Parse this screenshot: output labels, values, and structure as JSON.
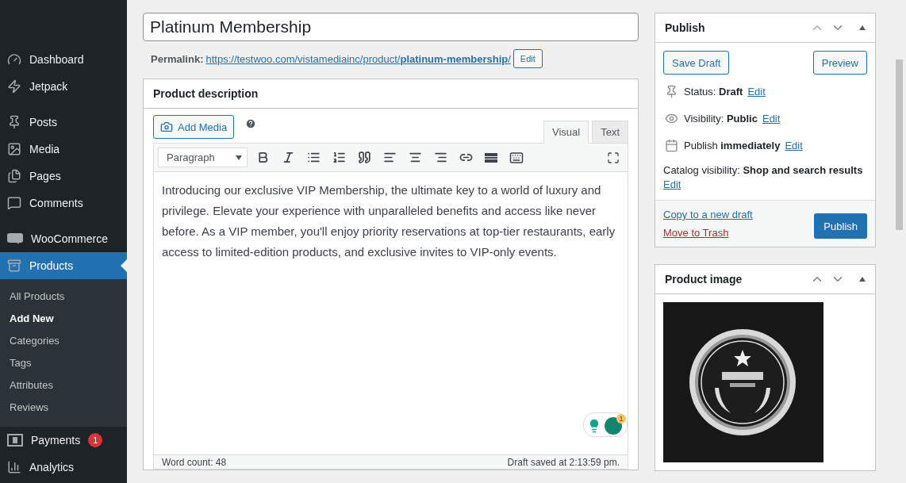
{
  "sidebar": {
    "groups": [
      [
        {
          "label": "Dashboard",
          "selected": false
        },
        {
          "label": "Jetpack",
          "selected": false
        }
      ],
      [
        {
          "label": "Posts",
          "selected": false
        },
        {
          "label": "Media",
          "selected": false
        },
        {
          "label": "Pages",
          "selected": false
        },
        {
          "label": "Comments",
          "selected": false
        }
      ],
      [
        {
          "label": "WooCommerce",
          "selected": false
        },
        {
          "label": "Products",
          "selected": true,
          "children": [
            {
              "label": "All Products",
              "selected": false
            },
            {
              "label": "Add New",
              "selected": true
            },
            {
              "label": "Categories",
              "selected": false
            },
            {
              "label": "Tags",
              "selected": false
            },
            {
              "label": "Attributes",
              "selected": false
            },
            {
              "label": "Reviews",
              "selected": false
            }
          ]
        },
        {
          "label": "Payments",
          "selected": false,
          "badge": "1"
        },
        {
          "label": "Analytics",
          "selected": false
        }
      ]
    ]
  },
  "title_field": {
    "value": "Platinum Membership"
  },
  "permalink": {
    "label": "Permalink:",
    "url": "https://testwoo.com/vistamediainc/product/**platinum-membership**/",
    "button": "Edit"
  },
  "description": {
    "title": "Product description",
    "add_media": "Add Media",
    "tabs": [
      {
        "label": "Visual",
        "selected": true
      },
      {
        "label": "Text",
        "selected": false
      }
    ],
    "format": "Paragraph",
    "body": "Introducing our exclusive VIP Membership, the ultimate key to a world of luxury and privilege. Elevate your experience with unparalleled benefits and access like never before. As a VIP member, you'll enjoy priority reservations at top-tier restaurants, early access to limited-edition products, and exclusive invites to VIP-only events.",
    "grammarly_badge": "1",
    "word_count": "Word count: 48",
    "draft_saved": "Draft saved at 2:13:59 pm."
  },
  "publish": {
    "title": "Publish",
    "save_draft": "Save Draft",
    "preview": "Preview",
    "rows": [
      {
        "text": "Status: **Draft**",
        "link": "Edit"
      },
      {
        "text": "Visibility: **Public**",
        "link": "Edit"
      },
      {
        "text": "Publish **immediately**",
        "link": "Edit"
      }
    ],
    "catalog": {
      "text": "Catalog visibility: **Shop and search results**",
      "link": "Edit"
    },
    "copy_link": "Copy to a new draft",
    "trash_link": "Move to Trash",
    "publish_button": "Publish"
  },
  "product_image": {
    "title": "Product image"
  }
}
